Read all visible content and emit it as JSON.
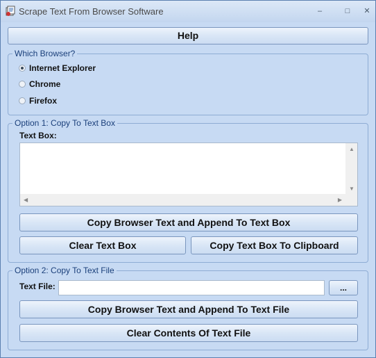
{
  "window": {
    "title": "Scrape Text From Browser Software",
    "minimize": "–",
    "maximize": "□",
    "close": "✕"
  },
  "help_button": "Help",
  "browser_group": {
    "legend": "Which Browser?",
    "options": [
      {
        "label": "Internet Explorer",
        "selected": true
      },
      {
        "label": "Chrome",
        "selected": false
      },
      {
        "label": "Firefox",
        "selected": false
      }
    ]
  },
  "option1": {
    "legend": "Option 1: Copy To Text Box",
    "textbox_label": "Text Box:",
    "textbox_value": "",
    "copy_append_button": "Copy Browser Text and Append To Text Box",
    "clear_button": "Clear Text Box",
    "clipboard_button": "Copy Text Box To Clipboard"
  },
  "option2": {
    "legend": "Option 2: Copy To Text File",
    "textfile_label": "Text File:",
    "textfile_value": "",
    "browse_button": "...",
    "copy_append_button": "Copy Browser Text and Append To Text File",
    "clear_button": "Clear Contents Of Text File"
  }
}
